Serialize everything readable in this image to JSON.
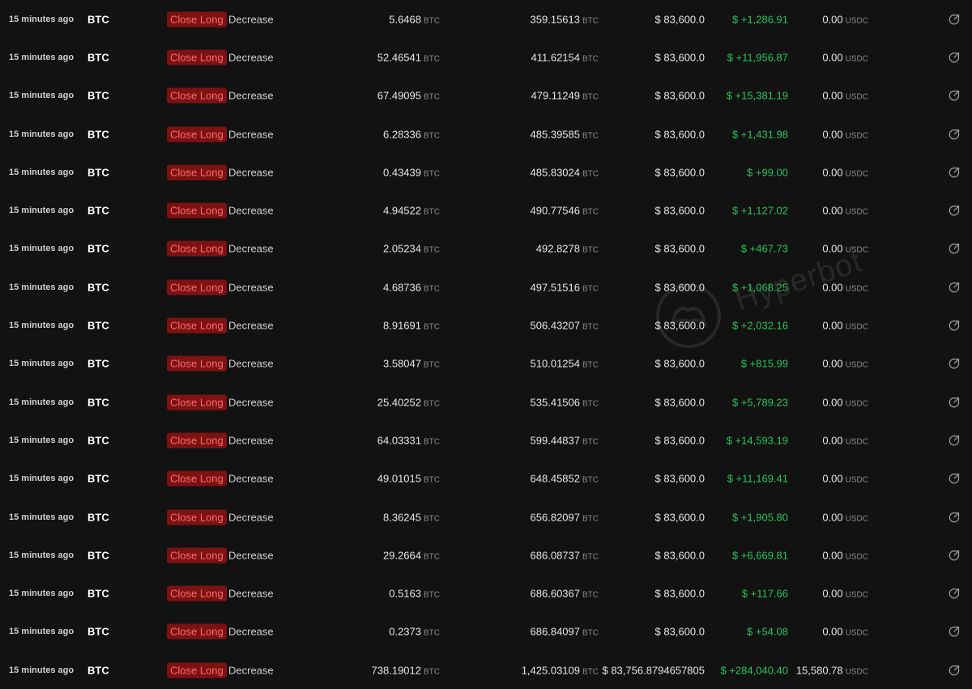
{
  "units": {
    "size": "BTC",
    "total": "BTC",
    "fee": "USDC"
  },
  "colors": {
    "background": "#121212",
    "badge_bg": "#7d1212",
    "badge_text": "#ff6a6a",
    "pnl_positive": "#27c55a"
  },
  "watermark": {
    "text": "Hyperbot"
  },
  "rows": [
    {
      "time": "15 minutes ago",
      "coin": "BTC",
      "action": "Close Long",
      "direction": "Decrease",
      "size": "5.6468",
      "total": "359.15613",
      "price": "$ 83,600.0",
      "pnl": "$ +1,286.91",
      "fee": "0.00"
    },
    {
      "time": "15 minutes ago",
      "coin": "BTC",
      "action": "Close Long",
      "direction": "Decrease",
      "size": "52.46541",
      "total": "411.62154",
      "price": "$ 83,600.0",
      "pnl": "$ +11,956.87",
      "fee": "0.00"
    },
    {
      "time": "15 minutes ago",
      "coin": "BTC",
      "action": "Close Long",
      "direction": "Decrease",
      "size": "67.49095",
      "total": "479.11249",
      "price": "$ 83,600.0",
      "pnl": "$ +15,381.19",
      "fee": "0.00"
    },
    {
      "time": "15 minutes ago",
      "coin": "BTC",
      "action": "Close Long",
      "direction": "Decrease",
      "size": "6.28336",
      "total": "485.39585",
      "price": "$ 83,600.0",
      "pnl": "$ +1,431.98",
      "fee": "0.00"
    },
    {
      "time": "15 minutes ago",
      "coin": "BTC",
      "action": "Close Long",
      "direction": "Decrease",
      "size": "0.43439",
      "total": "485.83024",
      "price": "$ 83,600.0",
      "pnl": "$ +99.00",
      "fee": "0.00"
    },
    {
      "time": "15 minutes ago",
      "coin": "BTC",
      "action": "Close Long",
      "direction": "Decrease",
      "size": "4.94522",
      "total": "490.77546",
      "price": "$ 83,600.0",
      "pnl": "$ +1,127.02",
      "fee": "0.00"
    },
    {
      "time": "15 minutes ago",
      "coin": "BTC",
      "action": "Close Long",
      "direction": "Decrease",
      "size": "2.05234",
      "total": "492.8278",
      "price": "$ 83,600.0",
      "pnl": "$ +467.73",
      "fee": "0.00"
    },
    {
      "time": "15 minutes ago",
      "coin": "BTC",
      "action": "Close Long",
      "direction": "Decrease",
      "size": "4.68736",
      "total": "497.51516",
      "price": "$ 83,600.0",
      "pnl": "$ +1,068.25",
      "fee": "0.00"
    },
    {
      "time": "15 minutes ago",
      "coin": "BTC",
      "action": "Close Long",
      "direction": "Decrease",
      "size": "8.91691",
      "total": "506.43207",
      "price": "$ 83,600.0",
      "pnl": "$ +2,032.16",
      "fee": "0.00"
    },
    {
      "time": "15 minutes ago",
      "coin": "BTC",
      "action": "Close Long",
      "direction": "Decrease",
      "size": "3.58047",
      "total": "510.01254",
      "price": "$ 83,600.0",
      "pnl": "$ +815.99",
      "fee": "0.00"
    },
    {
      "time": "15 minutes ago",
      "coin": "BTC",
      "action": "Close Long",
      "direction": "Decrease",
      "size": "25.40252",
      "total": "535.41506",
      "price": "$ 83,600.0",
      "pnl": "$ +5,789.23",
      "fee": "0.00"
    },
    {
      "time": "15 minutes ago",
      "coin": "BTC",
      "action": "Close Long",
      "direction": "Decrease",
      "size": "64.03331",
      "total": "599.44837",
      "price": "$ 83,600.0",
      "pnl": "$ +14,593.19",
      "fee": "0.00"
    },
    {
      "time": "15 minutes ago",
      "coin": "BTC",
      "action": "Close Long",
      "direction": "Decrease",
      "size": "49.01015",
      "total": "648.45852",
      "price": "$ 83,600.0",
      "pnl": "$ +11,169.41",
      "fee": "0.00"
    },
    {
      "time": "15 minutes ago",
      "coin": "BTC",
      "action": "Close Long",
      "direction": "Decrease",
      "size": "8.36245",
      "total": "656.82097",
      "price": "$ 83,600.0",
      "pnl": "$ +1,905.80",
      "fee": "0.00"
    },
    {
      "time": "15 minutes ago",
      "coin": "BTC",
      "action": "Close Long",
      "direction": "Decrease",
      "size": "29.2664",
      "total": "686.08737",
      "price": "$ 83,600.0",
      "pnl": "$ +6,669.81",
      "fee": "0.00"
    },
    {
      "time": "15 minutes ago",
      "coin": "BTC",
      "action": "Close Long",
      "direction": "Decrease",
      "size": "0.5163",
      "total": "686.60367",
      "price": "$ 83,600.0",
      "pnl": "$ +117.66",
      "fee": "0.00"
    },
    {
      "time": "15 minutes ago",
      "coin": "BTC",
      "action": "Close Long",
      "direction": "Decrease",
      "size": "0.2373",
      "total": "686.84097",
      "price": "$ 83,600.0",
      "pnl": "$ +54.08",
      "fee": "0.00"
    },
    {
      "time": "15 minutes ago",
      "coin": "BTC",
      "action": "Close Long",
      "direction": "Decrease",
      "size": "738.19012",
      "total": "1,425.03109",
      "price": "$ 83,756.8794657805",
      "pnl": "$ +284,040.40",
      "fee": "15,580.78"
    }
  ]
}
